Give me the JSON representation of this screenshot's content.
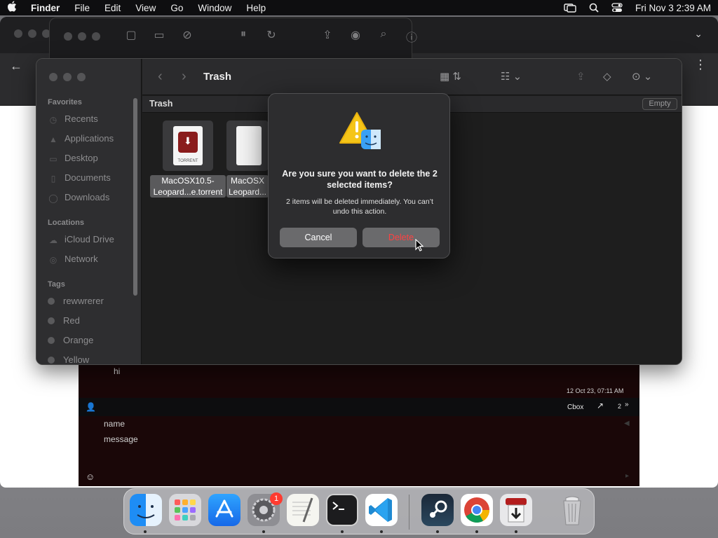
{
  "menubar": {
    "app_name": "Finder",
    "items": [
      "File",
      "Edit",
      "View",
      "Go",
      "Window",
      "Help"
    ],
    "datetime": "Fri Nov 3  2:39 AM"
  },
  "finder": {
    "title": "Trash",
    "path_label": "Trash",
    "empty_button": "Empty",
    "sidebar": {
      "favorites_header": "Favorites",
      "favorites": [
        "Recents",
        "Applications",
        "Desktop",
        "Documents",
        "Downloads"
      ],
      "locations_header": "Locations",
      "locations": [
        "iCloud Drive",
        "Network"
      ],
      "tags_header": "Tags",
      "tags": [
        "rewwrerer",
        "Red",
        "Orange",
        "Yellow"
      ]
    },
    "files": [
      {
        "name_line1": "MacOSX10.5-",
        "name_line2": "Leopard...e.torrent",
        "icon_label": "TORRENT"
      },
      {
        "name_line1": "MacOSX",
        "name_line2": "Leopard..."
      }
    ]
  },
  "alert": {
    "heading": "Are you sure you want to delete the 2 selected items?",
    "body": "2 items will be deleted immediately. You can’t undo this action.",
    "cancel_label": "Cancel",
    "delete_label": "Delete"
  },
  "chat": {
    "message": "hi",
    "timestamp": "12 Oct 23, 07:11 AM",
    "cbox_label": "Cbox",
    "count": "2",
    "name_placeholder": "name",
    "message_placeholder": "message"
  },
  "dock": {
    "apps": [
      "finder",
      "launchpad",
      "app-store",
      "system-settings",
      "textedit",
      "terminal",
      "vscode",
      "steam",
      "chrome",
      "transmission",
      "trash"
    ],
    "settings_badge": "1"
  }
}
